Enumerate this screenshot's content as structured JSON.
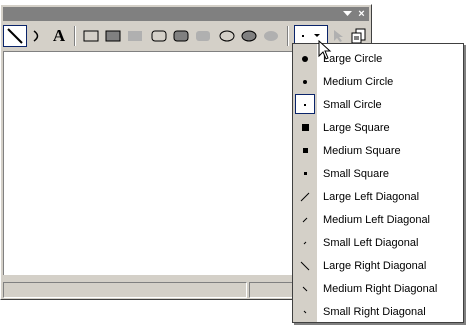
{
  "window": {
    "titlebar_buttons": {
      "dropdown_icon": "chevron-down-icon",
      "close_label": "×"
    }
  },
  "toolbar": {
    "tools": [
      {
        "name": "line-tool",
        "icon": "line-icon",
        "selected": true
      },
      {
        "name": "arc-tool",
        "icon": "arc-icon"
      },
      {
        "name": "text-tool",
        "icon": "text-icon",
        "label": "A"
      },
      {
        "name": "rectangle-tool",
        "icon": "rectangle-icon"
      },
      {
        "name": "filled-rectangle-tool",
        "icon": "filled-rectangle-icon"
      },
      {
        "name": "solid-rectangle-tool",
        "icon": "solid-rectangle-icon"
      },
      {
        "name": "rounded-rectangle-tool",
        "icon": "rounded-rectangle-icon"
      },
      {
        "name": "filled-rounded-rectangle-tool",
        "icon": "filled-rounded-rectangle-icon"
      },
      {
        "name": "solid-rounded-rectangle-tool",
        "icon": "solid-rounded-rectangle-icon"
      },
      {
        "name": "ellipse-tool",
        "icon": "ellipse-icon"
      },
      {
        "name": "filled-ellipse-tool",
        "icon": "filled-ellipse-icon"
      },
      {
        "name": "solid-ellipse-tool",
        "icon": "solid-ellipse-icon"
      },
      {
        "name": "brush-shape-dropdown",
        "icon": "small-dot-icon"
      },
      {
        "name": "select-tool",
        "icon": "pointer-icon"
      },
      {
        "name": "copy-tool",
        "icon": "copy-icon"
      }
    ]
  },
  "menu": {
    "items": [
      {
        "label": "Large Circle",
        "icon": "large-circle-icon",
        "checked": false
      },
      {
        "label": "Medium Circle",
        "icon": "medium-circle-icon",
        "checked": false
      },
      {
        "label": "Small Circle",
        "icon": "small-circle-icon",
        "checked": true
      },
      {
        "label": "Large Square",
        "icon": "large-square-icon",
        "checked": false
      },
      {
        "label": "Medium Square",
        "icon": "medium-square-icon",
        "checked": false
      },
      {
        "label": "Small Square",
        "icon": "small-square-icon",
        "checked": false
      },
      {
        "label": "Large Left Diagonal",
        "icon": "large-left-diagonal-icon",
        "checked": false
      },
      {
        "label": "Medium Left Diagonal",
        "icon": "medium-left-diagonal-icon",
        "checked": false
      },
      {
        "label": "Small Left Diagonal",
        "icon": "small-left-diagonal-icon",
        "checked": false
      },
      {
        "label": "Large Right Diagonal",
        "icon": "large-right-diagonal-icon",
        "checked": false
      },
      {
        "label": "Medium Right Diagonal",
        "icon": "medium-right-diagonal-icon",
        "checked": false
      },
      {
        "label": "Small Right Diagonal",
        "icon": "small-right-diagonal-icon",
        "checked": false
      }
    ]
  },
  "colors": {
    "face": "#d4d0c8",
    "titlebar": "#808080",
    "highlight_border": "#0a246a",
    "shape_fill": "#808080",
    "shape_disabled": "#b0b0b0"
  }
}
